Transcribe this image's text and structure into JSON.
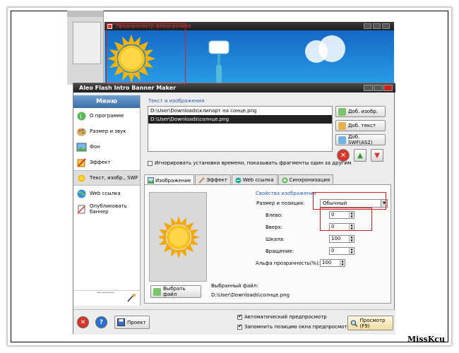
{
  "colors": {
    "accent_red": "#d21f1f",
    "sidebar_head": "#3b6ea8",
    "label_blue": "#2a5db0"
  },
  "preview_window": {
    "title": "Предпросмотр флеш-ролика"
  },
  "app": {
    "title": "Aleo Flash Intro Banner Maker"
  },
  "sidebar": {
    "header": "Меню",
    "items": [
      {
        "label": "О программе",
        "icon": "about-icon"
      },
      {
        "label": "Размер и звук",
        "icon": "palette-icon"
      },
      {
        "label": "Фон",
        "icon": "background-image-icon"
      },
      {
        "label": "Эффект",
        "icon": "effect-icon"
      },
      {
        "label": "Текст, изобр., SWF",
        "icon": "text-image-icon",
        "active": true
      },
      {
        "label": "Web ссылка",
        "icon": "globe-icon"
      },
      {
        "label": "Опубликовать баннер",
        "icon": "publish-icon"
      }
    ]
  },
  "content": {
    "group_label": "Текст и изображения",
    "files": [
      {
        "path": "D:\\User\\Downloads\\клипарт на сонце.png",
        "selected": false
      },
      {
        "path": "D:\\User\\Downloads\\солнце.png",
        "selected": true
      }
    ],
    "buttons": {
      "add_image": "Доб. изобр.",
      "add_text": "Доб. текст",
      "add_swf": "Доб. SWF(AS2)"
    },
    "ignore_time_checkbox": {
      "label": "Игнорировать установки времени, показывать фрагменты один за другим",
      "checked": false
    }
  },
  "tabs": [
    {
      "label": "Изображение",
      "icon": "image-tab-icon",
      "active": true
    },
    {
      "label": "Эффект",
      "icon": "brush-icon",
      "active": false
    },
    {
      "label": "Web ссылка",
      "icon": "link-icon",
      "active": false
    },
    {
      "label": "Синхронизация",
      "icon": "sync-icon",
      "active": false
    }
  ],
  "image_props": {
    "group_label": "Свойства изображения",
    "size_position_label": "Размер и позиция:",
    "size_position_value": "Обычный",
    "left_label": "Влево:",
    "left_value": "0",
    "up_label": "Вверх:",
    "up_value": "0",
    "scale_label": "Шкала:",
    "scale_value": "100",
    "rotation_label": "Вращение:",
    "rotation_value": "0",
    "alpha_label": "Альфа прозрачность(%):",
    "alpha_value": "100"
  },
  "file_section": {
    "choose_button": "Выбрать файл",
    "selected_label": "Выбранный файл:",
    "selected_path": "D:\\User\\Downloads\\солнце.png"
  },
  "bottom": {
    "project_button": "Проект",
    "auto_preview": {
      "label": "Автоматический предпросмотр",
      "checked": true
    },
    "remember_position": {
      "label": "Запомнить позицию окна предпросмотра",
      "checked": true
    },
    "preview_button": "Просмотр (F9)"
  },
  "watermark": "MissKcu"
}
